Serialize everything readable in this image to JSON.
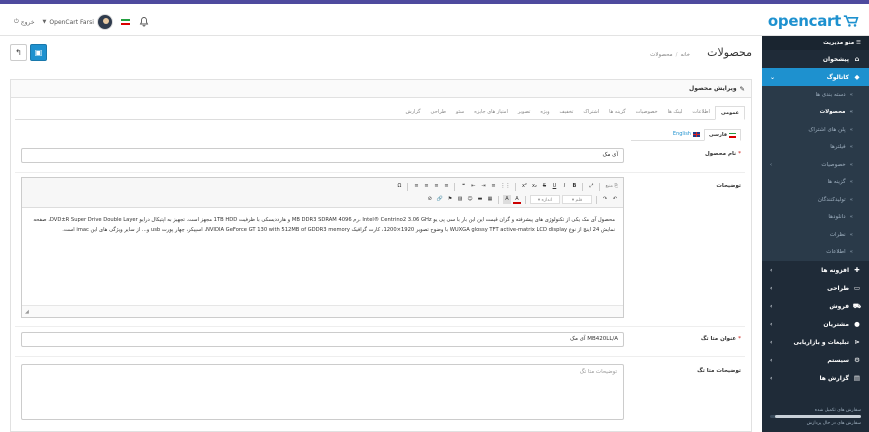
{
  "header": {
    "logo_text": "opencart",
    "logout_label": "خروج",
    "user_name": "OpenCart Farsi",
    "accent": "#1e91cf",
    "top_border_color": "#4e4a9e"
  },
  "sidebar": {
    "title": "منو مدیریت",
    "items": [
      {
        "label": "پیشخوان",
        "icon": "home-icon"
      },
      {
        "label": "کاتالوگ",
        "icon": "tag-icon",
        "active": true
      },
      {
        "label": "افزونه ها",
        "icon": "puzzle-icon"
      },
      {
        "label": "طراحی",
        "icon": "monitor-icon"
      },
      {
        "label": "فروش",
        "icon": "cart-icon"
      },
      {
        "label": "مشتریان",
        "icon": "user-icon"
      },
      {
        "label": "تبلیغات و بازاریابی",
        "icon": "share-icon"
      },
      {
        "label": "سیستم",
        "icon": "gear-icon"
      },
      {
        "label": "گزارش ها",
        "icon": "bar-chart-icon"
      }
    ],
    "catalog_sub": [
      "دسته بندی ها",
      "محصولات",
      "پلن های اشتراک",
      "فیلترها",
      "خصوصیات",
      "گزینه ها",
      "تولیدکنندگان",
      "دانلودها",
      "نظرات",
      "اطلاعات"
    ],
    "progress": [
      {
        "label": "سفارش های تکمیل شده",
        "value": 0.95,
        "color": "#c8d0d8"
      },
      {
        "label": "سفارش های در حال پردازش",
        "value": 0.55,
        "color": "#c8d0d8"
      }
    ]
  },
  "page": {
    "title": "محصولات",
    "breadcrumb": [
      "خانه",
      "محصولات"
    ]
  },
  "panel": {
    "heading": "ویرایش محصول",
    "tabs": [
      "عمومی",
      "اطلاعات",
      "لینک ها",
      "خصوصیات",
      "گزینه ها",
      "اشتراک",
      "تخفیف",
      "ویژه",
      "تصویر",
      "امتیاز های جایزه",
      "سئو",
      "طراحی",
      "گزارش"
    ],
    "lang_tabs": [
      "فارسی",
      "English"
    ]
  },
  "form": {
    "name_label": "نام محصول",
    "name_value": "آی مک",
    "desc_label": "توضیحات",
    "desc_text": "محصول آی مک یکی از تکنولوژی های پیشرفته و گران قیمت این این بار با سی پی یو Intel® Centrino2 3.06 GHz ،رم 4096 MB DDR3 SDRAM و هارددیسکی با ظرفیت 1TB HDD مجهز است. تجهیز به اپتیکال درایو DVD±R Super Drive Double Layer، صفحه نمایش 24 اینچ از نوع WUXGA glossy TFT active-matrix LCD display با وضوح تصویر 1920×1200، کارت گرافیک NVIDIA GeForce GT 130 with 512MB of GDDR3 memory، اسپیکر، چهار پورت usb و... از سایر ویژگی های این imac است.",
    "toolbar_row1": [
      "منبع",
      "⤢",
      "B",
      "I",
      "U",
      "S",
      "x₂",
      "x²",
      "⋮⋮",
      "≡",
      "⇥",
      "⇤",
      "❝",
      "≡",
      "≡",
      "≡",
      "≡",
      "Ω"
    ],
    "toolbar_row2": [
      "↶",
      "↷",
      "قلم",
      "اندازه",
      "A",
      "A"
    ],
    "meta_title_label": "عنوان متا تگ",
    "meta_title_value": "MB420LL/A آی مک",
    "meta_desc_label": "توضیحات متا تگ",
    "meta_desc_placeholder": "توضیحات متا تگ"
  }
}
